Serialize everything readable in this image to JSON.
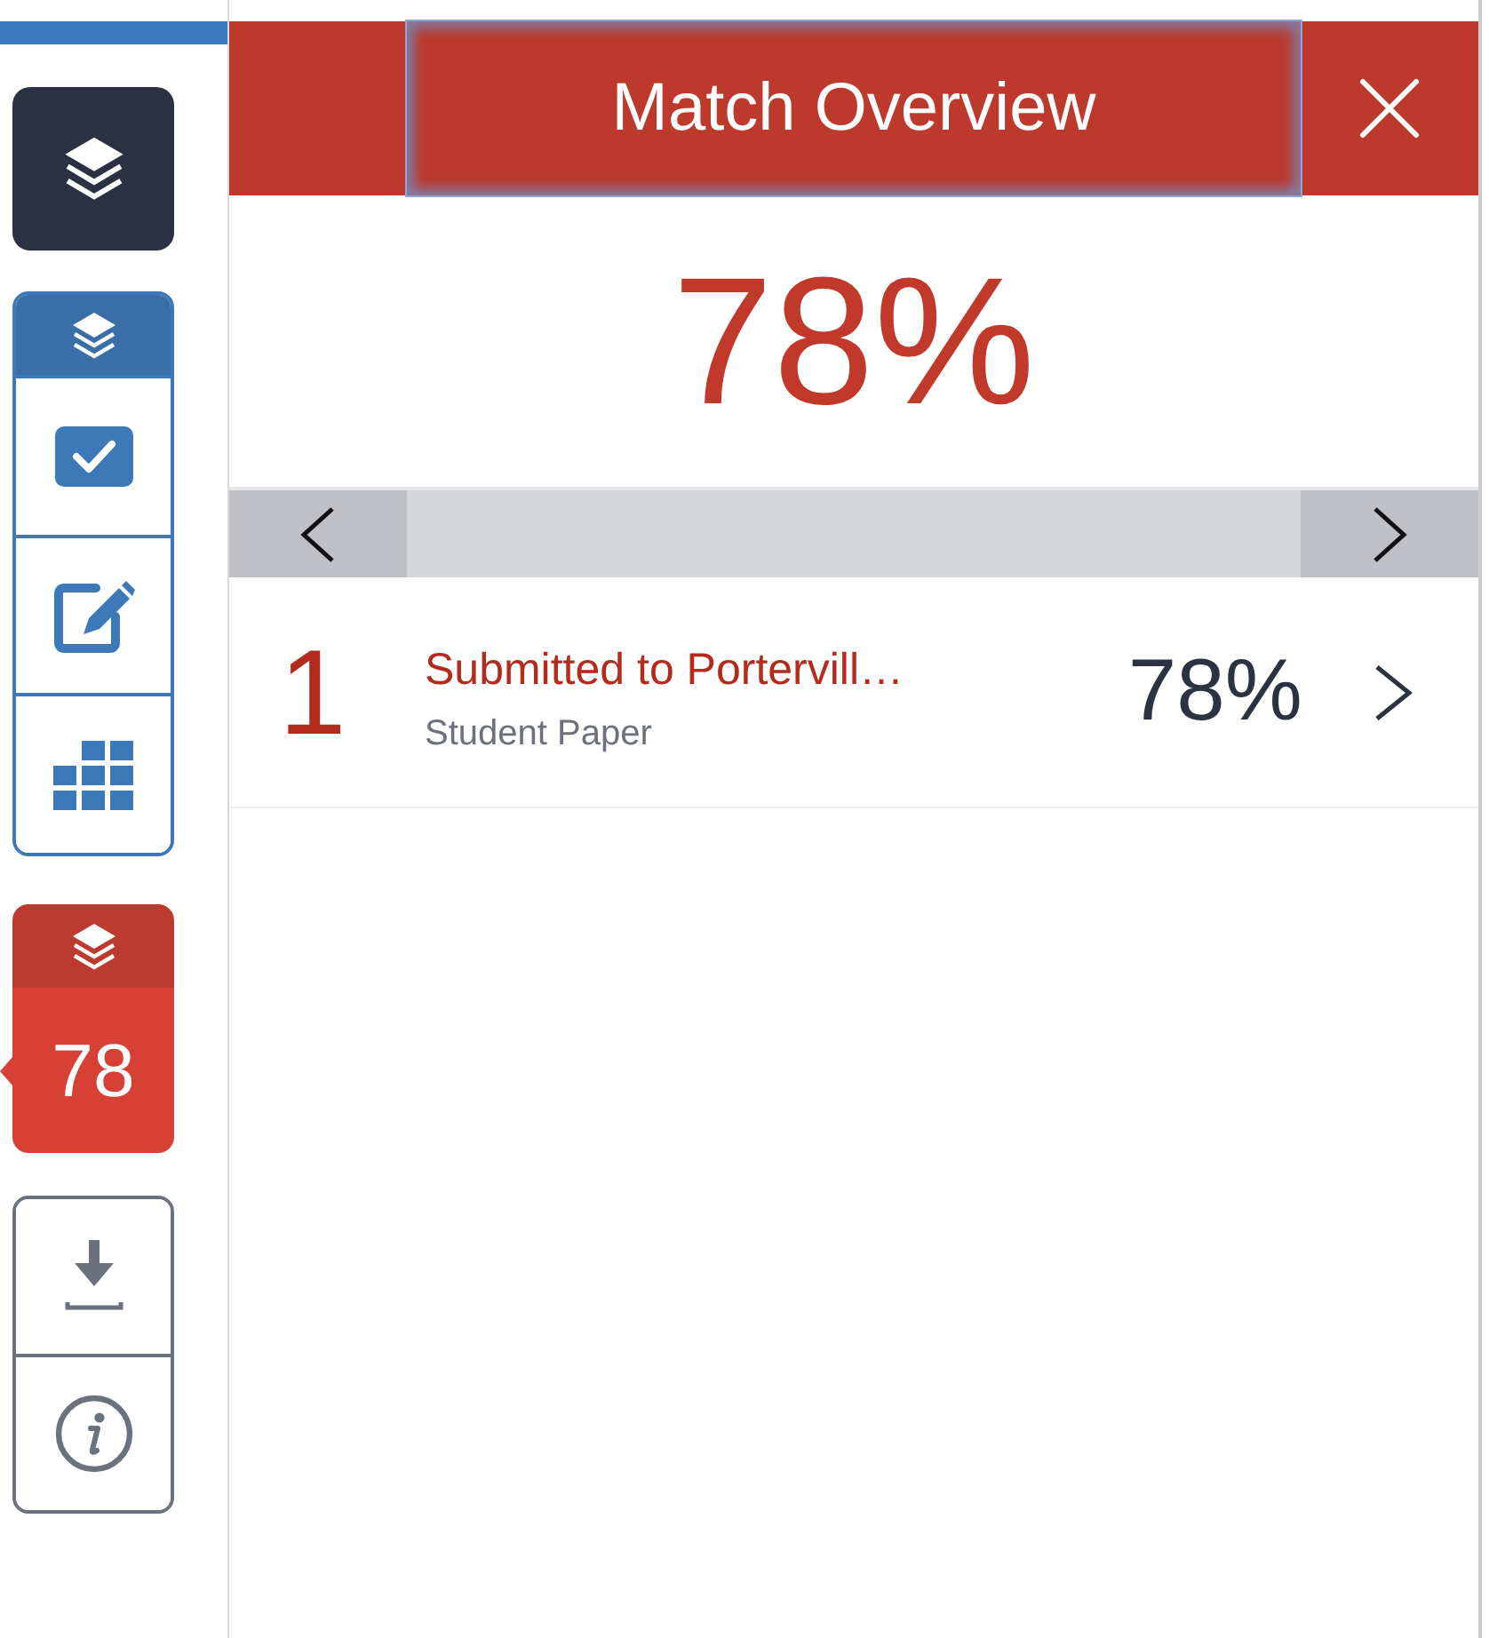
{
  "sidebar": {
    "score": {
      "value": "78",
      "selected": true
    }
  },
  "panel": {
    "title": "Match Overview",
    "title_focused": true,
    "overall_score": "78%",
    "matches": [
      {
        "number": "1",
        "source": "Submitted to Portervill…",
        "source_type": "Student Paper",
        "percent": "78%"
      }
    ]
  }
}
